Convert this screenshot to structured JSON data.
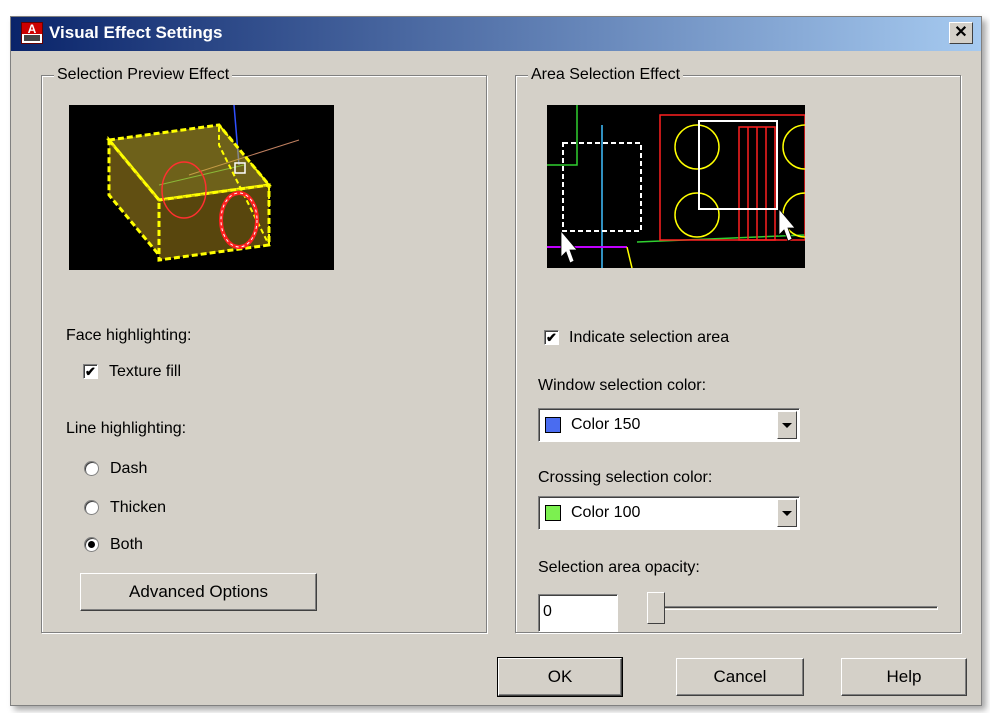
{
  "window": {
    "title": "Visual Effect Settings",
    "close_label": "✕",
    "app_icon_letter": "A"
  },
  "selection_preview": {
    "group_label": "Selection Preview Effect",
    "face_label": "Face highlighting:",
    "texture_fill_label": "Texture fill",
    "texture_fill_checked": true,
    "line_label": "Line highlighting:",
    "radios": [
      {
        "label": "Dash",
        "selected": false
      },
      {
        "label": "Thicken",
        "selected": false
      },
      {
        "label": "Both",
        "selected": true
      }
    ],
    "advanced_button": "Advanced Options"
  },
  "area_selection": {
    "group_label": "Area Selection Effect",
    "indicate_label": "Indicate selection area",
    "indicate_checked": true,
    "window_color_label": "Window selection color:",
    "window_color_value": "Color 150",
    "window_color_swatch": "#4a6cf0",
    "crossing_color_label": "Crossing selection color:",
    "crossing_color_value": "Color 100",
    "crossing_color_swatch": "#7cf050",
    "opacity_label": "Selection area opacity:",
    "opacity_value": "0"
  },
  "buttons": {
    "ok": "OK",
    "cancel": "Cancel",
    "help": "Help"
  },
  "check_glyph": "✔"
}
